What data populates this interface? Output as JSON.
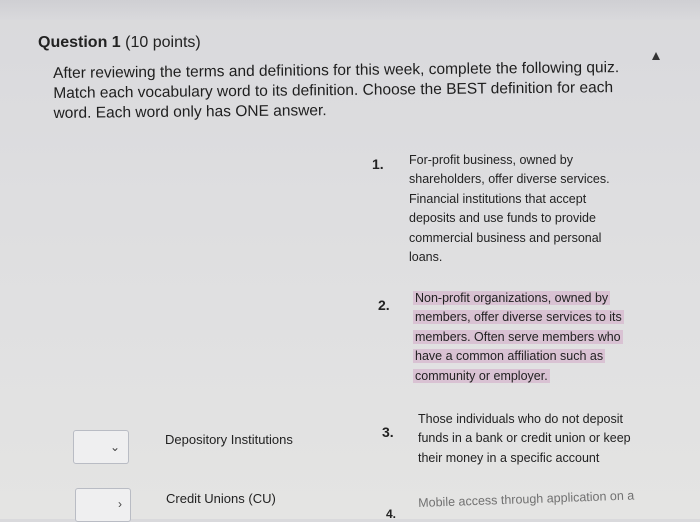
{
  "question": {
    "label": "Question 1",
    "points": "(10 points)",
    "instructions": "After reviewing the terms and definitions for this week, complete the following quiz. Match each vocabulary word to its definition. Choose the BEST definition for each word. Each word only has ONE answer."
  },
  "definitions": [
    {
      "number": "1.",
      "text": "For-profit business, owned by shareholders, offer diverse services. Financial institutions that accept deposits and use funds to provide commercial business and personal loans."
    },
    {
      "number": "2.",
      "text": "Non-profit organizations, owned by members, offer diverse services to its members. Often serve members who have a common affiliation such as community or employer."
    },
    {
      "number": "3.",
      "text": "Those individuals who do not deposit funds in a bank or credit union or keep their money in a specific account"
    },
    {
      "number": "4.",
      "text": "Mobile access through application on a"
    }
  ],
  "terms": [
    {
      "label": "Depository Institutions",
      "selected": ""
    },
    {
      "label": "Credit Unions (CU)",
      "selected": ""
    }
  ],
  "icons": {
    "chevron": "chevron-down-icon",
    "cursor": "mouse-cursor-icon"
  },
  "colors": {
    "highlight": "#d9c2d3"
  }
}
